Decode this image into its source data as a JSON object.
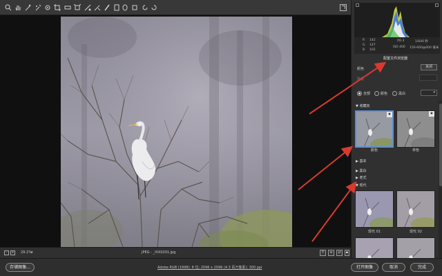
{
  "toolbar": {
    "tools": [
      "zoom-icon",
      "hand-icon",
      "white-balance-icon",
      "color-sampler-icon",
      "target-adjust-icon",
      "crop-icon",
      "straighten-icon",
      "transform-icon",
      "spot-removal-icon",
      "red-eye-icon",
      "adjust-brush-icon",
      "graduated-filter-icon",
      "radial-filter-icon",
      "preferences-icon",
      "rotate-left-icon",
      "rotate-right-icon"
    ]
  },
  "statusbar": {
    "zoom": "29.1%",
    "filename": "JPEG - _IXX0201.jpg"
  },
  "bottombar": {
    "save_label": "存储图像...",
    "workflow": "Adobe RGB (1998); 8 位; 2096 x 2096 (4.3 百万像素); 300 ppi",
    "open_label": "打开图像",
    "cancel_label": "取消",
    "done_label": "完成"
  },
  "exif": {
    "r_label": "R",
    "r_value": "142",
    "g_label": "G",
    "g_value": "147",
    "b_label": "B",
    "b_value": "102",
    "aperture": "f/6.3",
    "shutter": "1/640 秒",
    "iso": "ISO 400",
    "lens": "150-600@600 毫米"
  },
  "panel": {
    "profile_browser_title": "配置文件浏览器",
    "color_label": "颜色",
    "close_label": "关闭",
    "amount_label": "数量",
    "radio_all": "全部",
    "radio_color": "颜色",
    "radio_bw": "黑白",
    "filter_value": "▾"
  },
  "profiles": {
    "favorites_title": "收藏夹",
    "favorites": [
      {
        "label": "颜色"
      },
      {
        "label": "单色"
      }
    ],
    "basic_title": "基本",
    "bw_title": "黑白",
    "legacy_title": "老式",
    "modern_title": "现代",
    "modern": [
      {
        "label": "现代 01"
      },
      {
        "label": "现代 02"
      }
    ]
  }
}
